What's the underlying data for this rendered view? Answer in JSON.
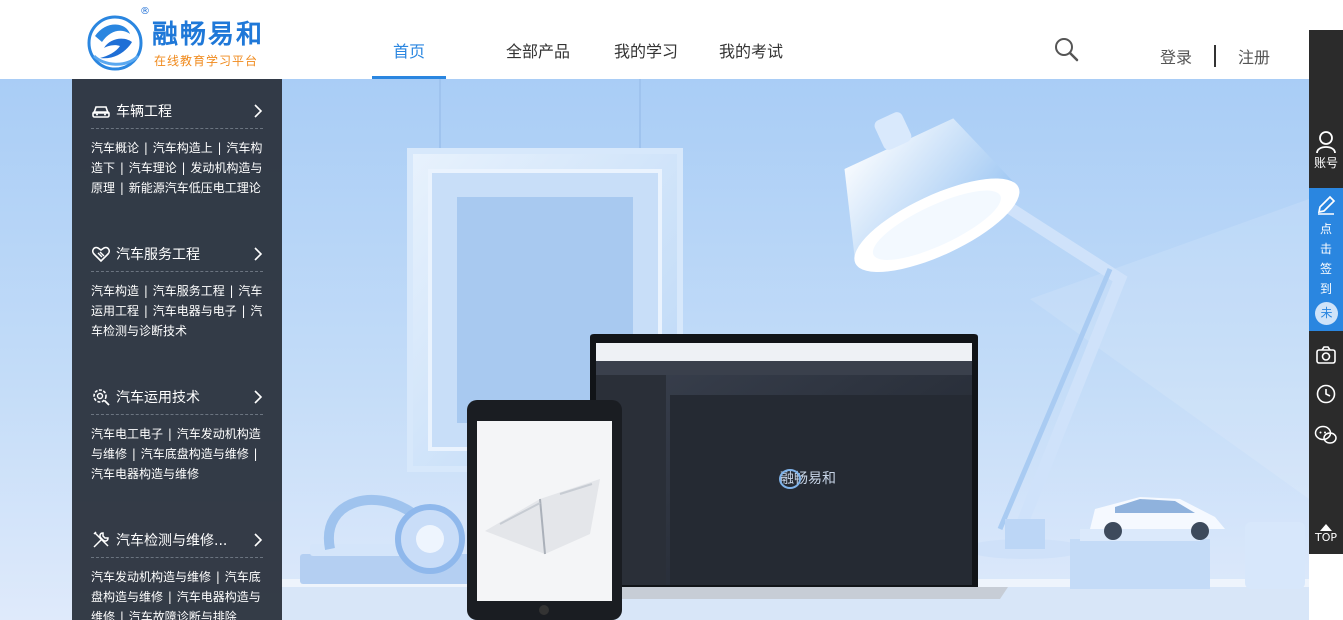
{
  "brand": {
    "name": "融畅易和",
    "tagline": "在线教育学习平台",
    "reg_mark": "®",
    "primary_color": "#2a86e0",
    "accent_color": "#f08a1c"
  },
  "nav": {
    "items": [
      "首页",
      "全部产品",
      "我的学习",
      "我的考试"
    ],
    "active_index": 0
  },
  "auth": {
    "login": "登录",
    "register": "注册"
  },
  "categories": [
    {
      "icon": "car-icon",
      "title": "车辆工程",
      "links": [
        "汽车概论",
        "汽车构造上",
        "汽车构造下",
        "汽车理论",
        "发动机构造与原理",
        "新能源汽车低压电工理论"
      ]
    },
    {
      "icon": "handshake-icon",
      "title": "汽车服务工程",
      "links": [
        "汽车构造",
        "汽车服务工程",
        "汽车运用工程",
        "汽车电器与电子",
        "汽车检测与诊断技术"
      ]
    },
    {
      "icon": "gear-search-icon",
      "title": "汽车运用技术",
      "links": [
        "汽车电工电子",
        "汽车发动机构造与维修",
        "汽车底盘构造与维修",
        "汽车电器构造与维修"
      ]
    },
    {
      "icon": "tools-icon",
      "title": "汽车检测与维修...",
      "links": [
        "汽车发动机构造与维修",
        "汽车底盘构造与维修",
        "汽车电器构造与维修",
        "汽车故障诊断与排除"
      ]
    }
  ],
  "rail": {
    "account": "账号",
    "sign_in_chars": [
      "点",
      "击",
      "签",
      "到"
    ],
    "sign_status": "未",
    "top": "TOP"
  },
  "banner": {
    "screen_brand": "融畅易和"
  }
}
